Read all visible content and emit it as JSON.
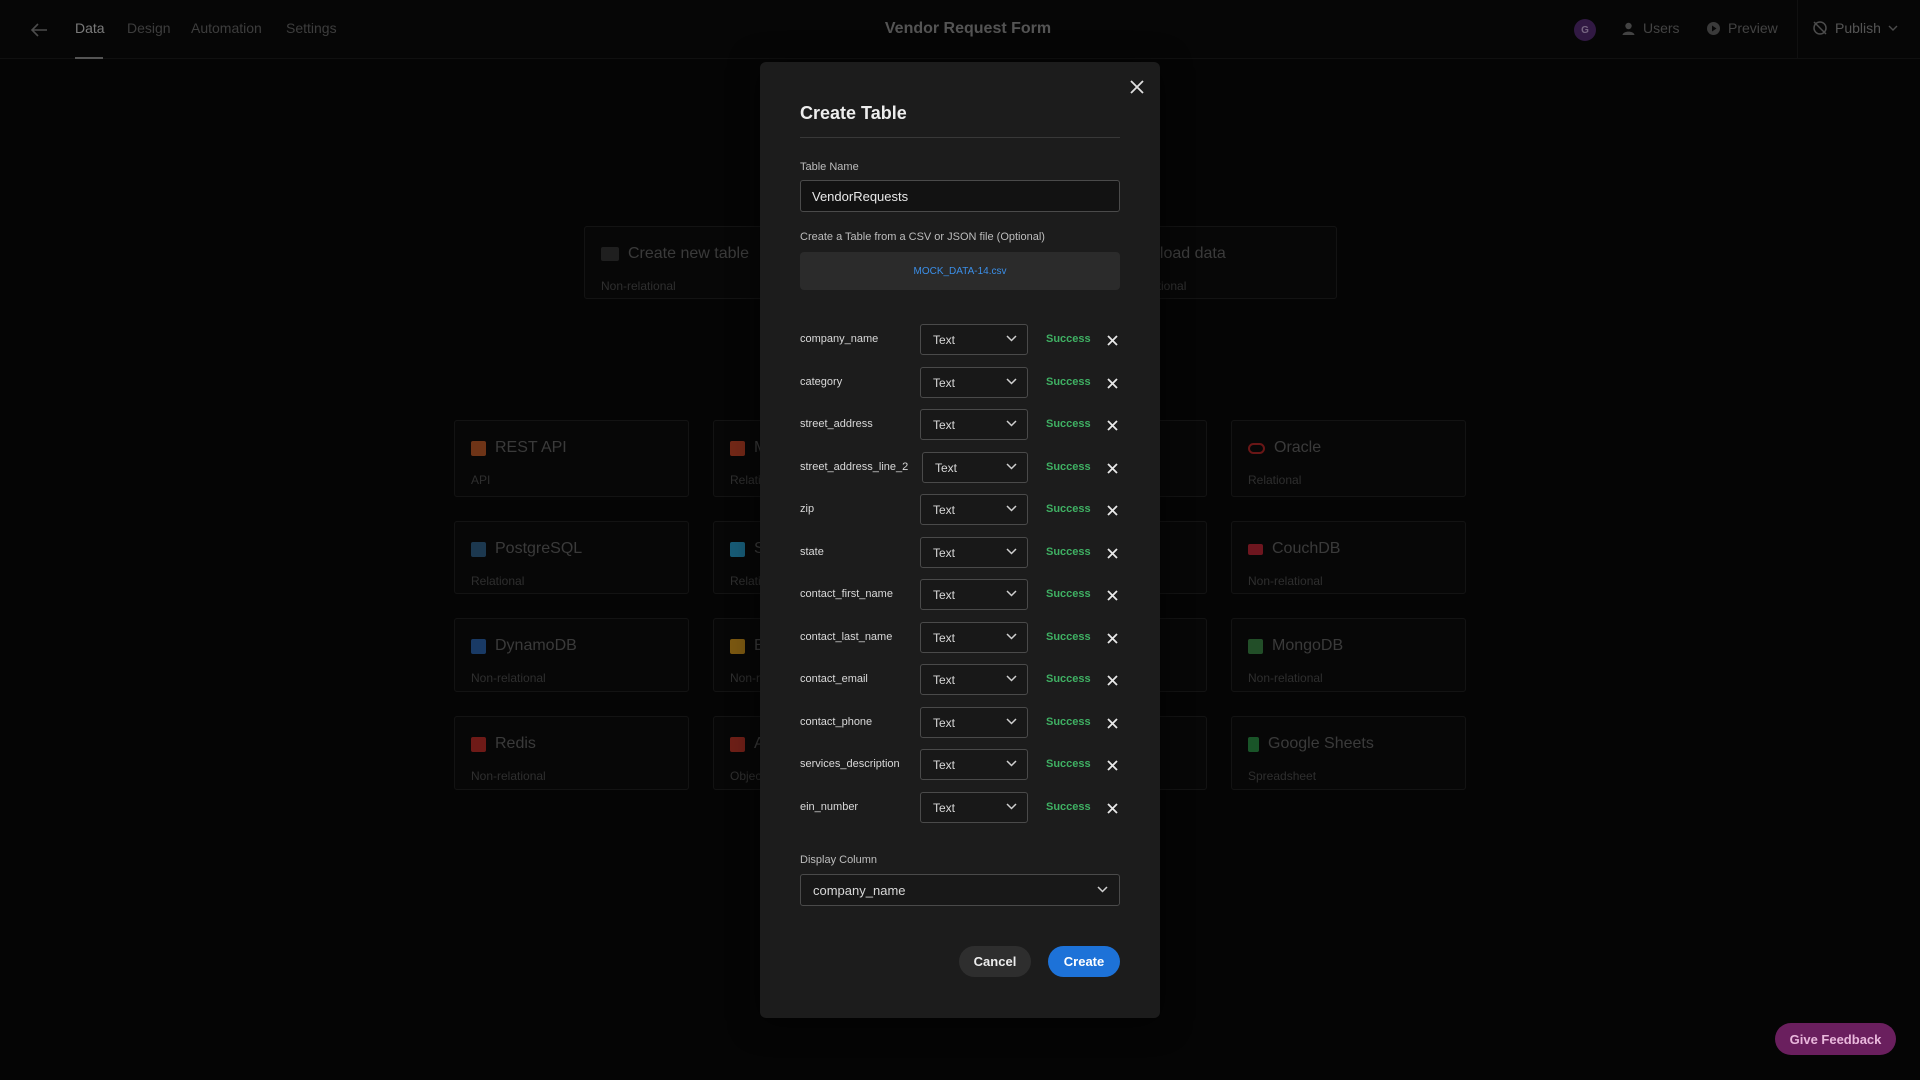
{
  "app": {
    "title": "Vendor Request Form"
  },
  "nav": {
    "tabs": [
      {
        "label": "Data"
      },
      {
        "label": "Design"
      },
      {
        "label": "Automation"
      },
      {
        "label": "Settings"
      }
    ]
  },
  "header": {
    "avatar_initial": "G",
    "users_label": "Users",
    "preview_label": "Preview",
    "publish_label": "Publish"
  },
  "background": {
    "top_cards": [
      {
        "title": "Create new table",
        "subtitle": "Non-relational",
        "icon": "budibase-icon"
      },
      {
        "title": "pload data",
        "subtitle": "ational",
        "icon": "upload-icon"
      }
    ],
    "datasources": [
      {
        "title": "REST API",
        "subtitle": "API",
        "icon": "rest-api-icon",
        "color": "#c8602a"
      },
      {
        "title": "M",
        "subtitle": "Relati",
        "icon": "microsoft-icon",
        "color": "#d24a2a"
      },
      {
        "title": "Oracle",
        "subtitle": "Relational",
        "icon": "oracle-icon",
        "color": "#c02828"
      },
      {
        "title": "PostgreSQL",
        "subtitle": "Relational",
        "icon": "postgresql-icon",
        "color": "#336791"
      },
      {
        "title": "S",
        "subtitle": "Relati",
        "icon": "snowflake-icon",
        "color": "#2aa6d8"
      },
      {
        "title": "CouchDB",
        "subtitle": "Non-relational",
        "icon": "couchdb-icon",
        "color": "#c8283a"
      },
      {
        "title": "DynamoDB",
        "subtitle": "Non-relational",
        "icon": "dynamodb-icon",
        "color": "#2f6bb8"
      },
      {
        "title": "E",
        "subtitle": "Non-r",
        "icon": "elastic-icon",
        "color": "#e0a020"
      },
      {
        "title": "MongoDB",
        "subtitle": "Non-relational",
        "icon": "mongodb-icon",
        "color": "#3f8f4a"
      },
      {
        "title": "Redis",
        "subtitle": "Non-relational",
        "icon": "redis-icon",
        "color": "#c8302a"
      },
      {
        "title": "A",
        "subtitle": "Objec",
        "icon": "aws-s3-icon",
        "color": "#c83a2a"
      },
      {
        "title": "Google Sheets",
        "subtitle": "Spreadsheet",
        "icon": "google-sheets-icon",
        "color": "#2f9a4a"
      }
    ]
  },
  "modal": {
    "title": "Create Table",
    "table_name_label": "Table Name",
    "table_name_value": "VendorRequests",
    "file_label": "Create a Table from a CSV or JSON file (Optional)",
    "file_name": "MOCK_DATA-14.csv",
    "columns": [
      {
        "name": "company_name",
        "type": "Text",
        "status": "Success"
      },
      {
        "name": "category",
        "type": "Text",
        "status": "Success"
      },
      {
        "name": "street_address",
        "type": "Text",
        "status": "Success"
      },
      {
        "name": "street_address_line_2",
        "type": "Text",
        "status": "Success"
      },
      {
        "name": "zip",
        "type": "Text",
        "status": "Success"
      },
      {
        "name": "state",
        "type": "Text",
        "status": "Success"
      },
      {
        "name": "contact_first_name",
        "type": "Text",
        "status": "Success"
      },
      {
        "name": "contact_last_name",
        "type": "Text",
        "status": "Success"
      },
      {
        "name": "contact_email",
        "type": "Text",
        "status": "Success"
      },
      {
        "name": "contact_phone",
        "type": "Text",
        "status": "Success"
      },
      {
        "name": "services_description",
        "type": "Text",
        "status": "Success"
      },
      {
        "name": "ein_number",
        "type": "Text",
        "status": "Success"
      }
    ],
    "display_column_label": "Display Column",
    "display_column_value": "company_name",
    "cancel_label": "Cancel",
    "create_label": "Create"
  },
  "feedback_label": "Give Feedback",
  "colors": {
    "accent": "#1d72d8",
    "success": "#3fb063",
    "feedback": "#6a1f5e"
  }
}
